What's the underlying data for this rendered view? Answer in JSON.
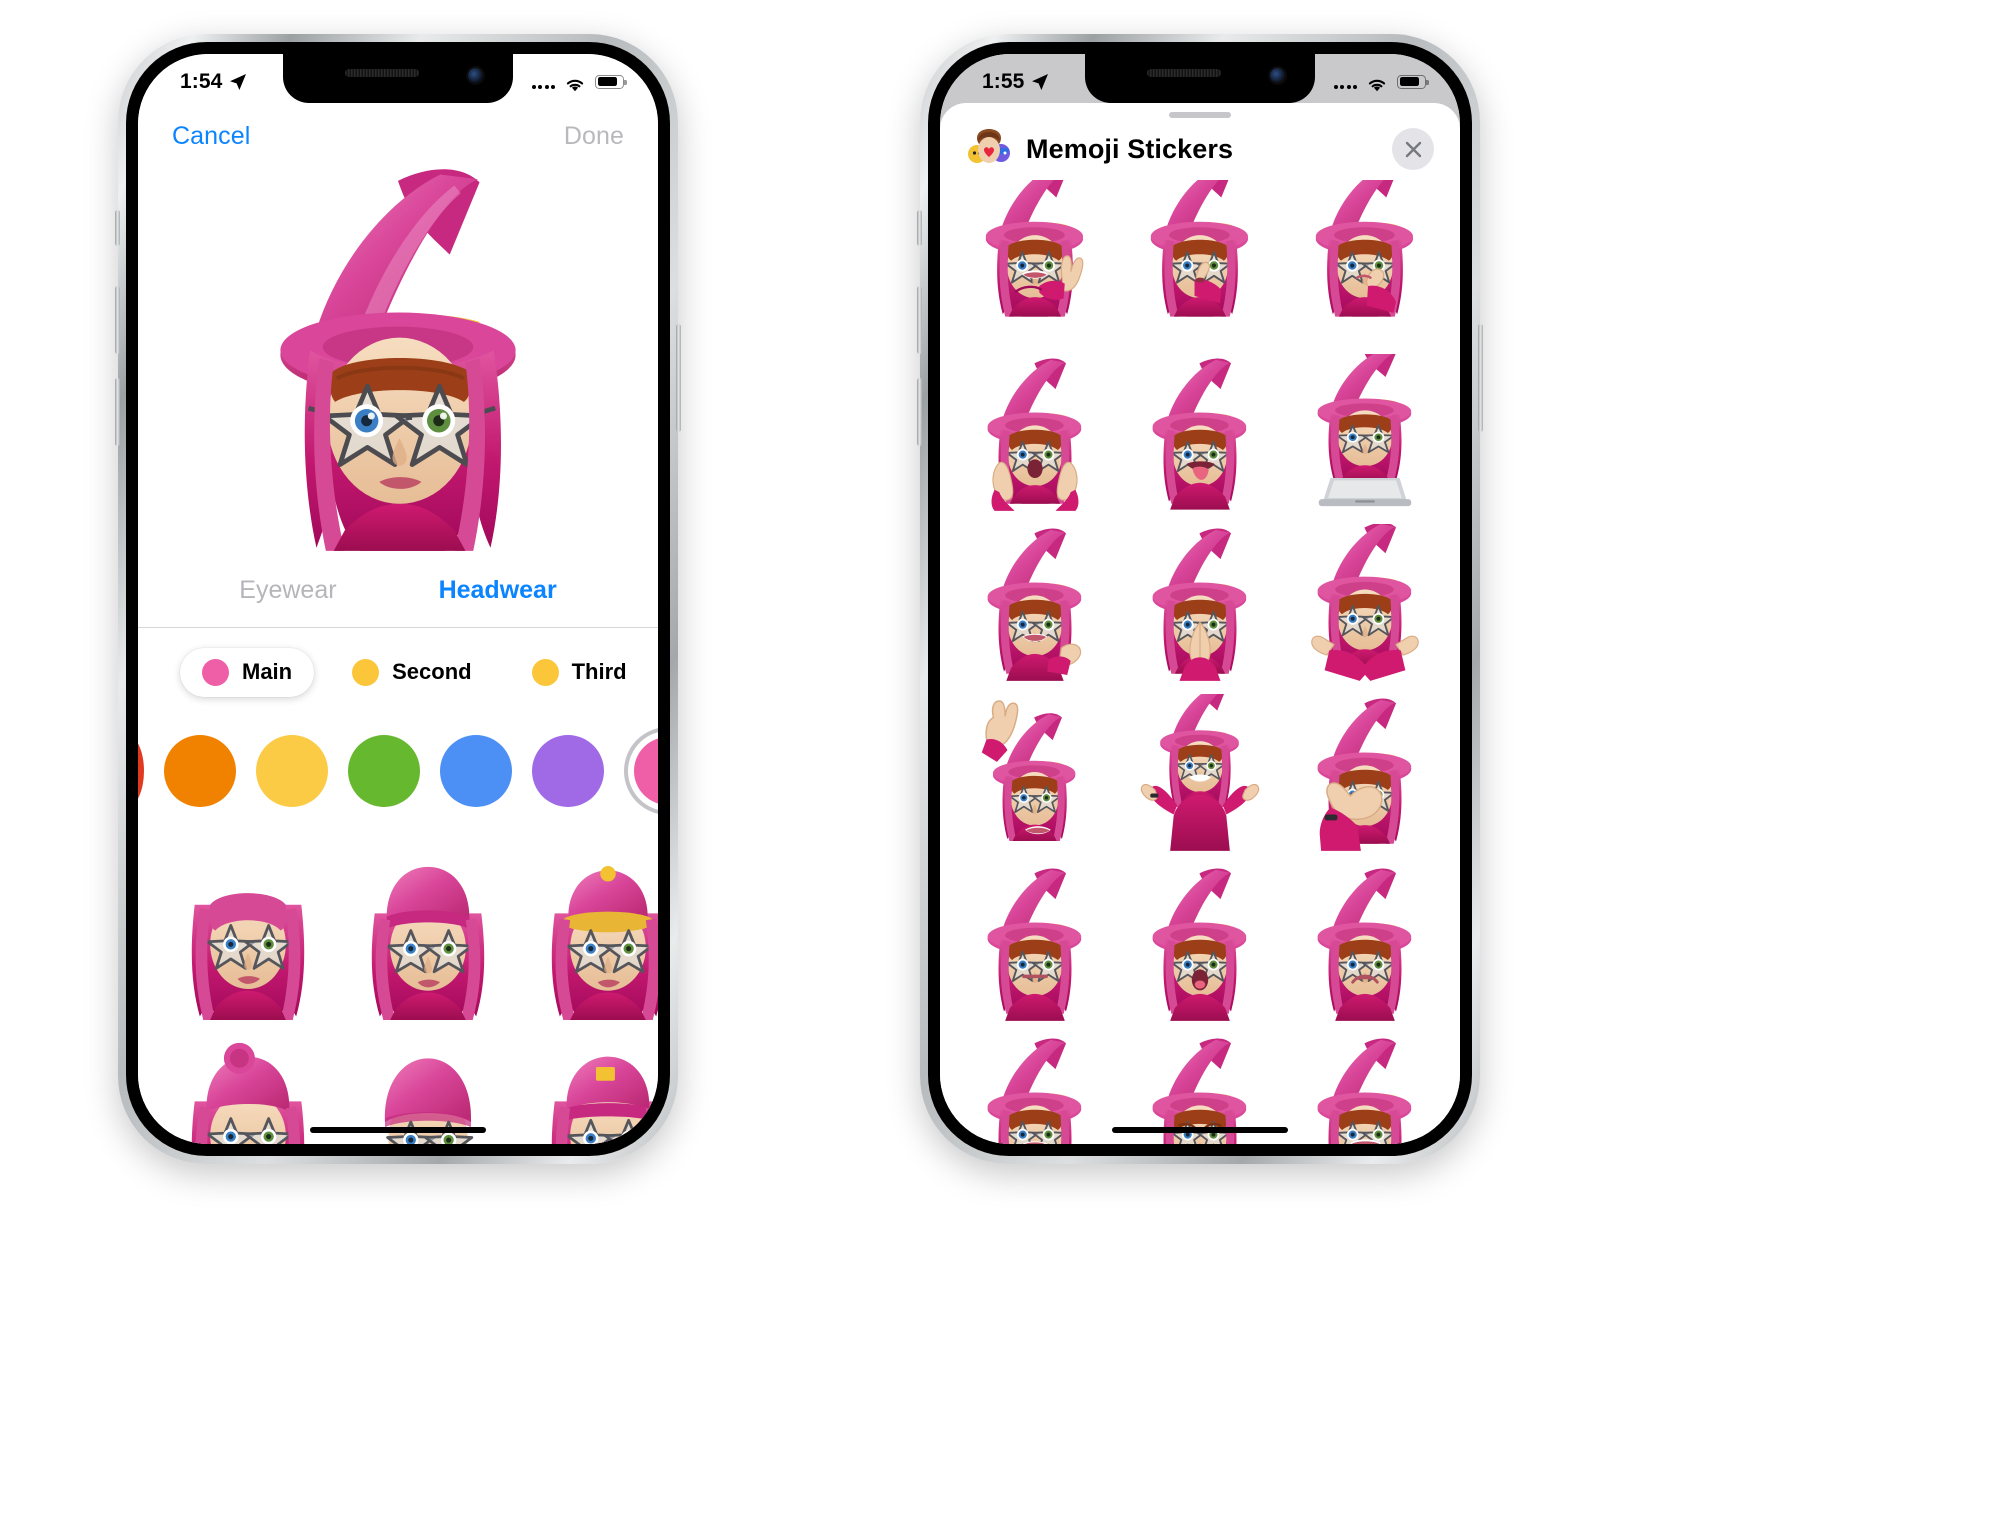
{
  "phones": [
    {
      "id": "memoji-editor",
      "status_bar": {
        "time": "1:54",
        "location_icon": "location-arrow-icon",
        "cellular_icon": "cellular-dots-icon",
        "wifi_icon": "wifi-icon",
        "battery_icon": "battery-icon",
        "battery_level_pct": 82,
        "recording_dot": true,
        "style": "light"
      },
      "nav": {
        "cancel_label": "Cancel",
        "done_label": "Done",
        "done_enabled": false
      },
      "tabs": [
        {
          "label": "Eyewear",
          "active": false
        },
        {
          "label": "Headwear",
          "active": true
        }
      ],
      "color_slots": [
        {
          "label": "Main",
          "color": "#ee5fa7",
          "selected": true
        },
        {
          "label": "Second",
          "color": "#fcc63b",
          "selected": false
        },
        {
          "label": "Third",
          "color": "#fcc63b",
          "selected": false
        }
      ],
      "swatches": [
        {
          "name": "red",
          "color": "#e03a21",
          "selected": false,
          "clipped": true
        },
        {
          "name": "orange",
          "color": "#f08200",
          "selected": false
        },
        {
          "name": "yellow",
          "color": "#fbcb45",
          "selected": false
        },
        {
          "name": "green",
          "color": "#66b92e",
          "selected": false
        },
        {
          "name": "blue",
          "color": "#4d90f5",
          "selected": false
        },
        {
          "name": "purple",
          "color": "#a06ae6",
          "selected": false
        },
        {
          "name": "pink",
          "color": "#ee5fa7",
          "selected": true
        }
      ],
      "headwear_options": [
        {
          "name": "no-hat-bangs",
          "hat": "none",
          "hat_color": "#d63d8b"
        },
        {
          "name": "beanie",
          "hat": "beanie",
          "hat_color": "#e05ba3"
        },
        {
          "name": "cap-with-button",
          "hat": "cap",
          "hat_color": "#e05ba3"
        },
        {
          "name": "bun-headband",
          "hat": "bun",
          "hat_color": "#d63d8b"
        },
        {
          "name": "swim-cap",
          "hat": "swimcap",
          "hat_color": "#e05ba3"
        },
        {
          "name": "baseball-cap",
          "hat": "baseball",
          "hat_color": "#e05ba3"
        }
      ],
      "accent_color": "#0a84ff",
      "tab_inactive_color": "#b5b5ba"
    },
    {
      "id": "memoji-stickers",
      "status_bar": {
        "time": "1:55",
        "location_icon": "location-arrow-icon",
        "cellular_icon": "cellular-dots-icon",
        "wifi_icon": "wifi-icon",
        "battery_icon": "battery-icon",
        "battery_level_pct": 82,
        "recording_dot": true,
        "style": "gray"
      },
      "sheet": {
        "app_icon": "memoji-stickers-app-icon",
        "title": "Memoji Stickers",
        "close_icon": "close-icon",
        "grabber": true
      },
      "stickers": [
        {
          "name": "sticker-peace-sign",
          "pose": "peace",
          "clipped": true
        },
        {
          "name": "sticker-shush",
          "pose": "shush",
          "clipped": true
        },
        {
          "name": "sticker-thinking",
          "pose": "thinking",
          "clipped": true
        },
        {
          "name": "sticker-shocked-hands",
          "pose": "shocked"
        },
        {
          "name": "sticker-tongue-out",
          "pose": "tongue"
        },
        {
          "name": "sticker-laptop",
          "pose": "laptop"
        },
        {
          "name": "sticker-wave-hand",
          "pose": "wave-small"
        },
        {
          "name": "sticker-praying",
          "pose": "pray"
        },
        {
          "name": "sticker-arms-crossed-x",
          "pose": "arms-x"
        },
        {
          "name": "sticker-raised-hand",
          "pose": "raised-hand"
        },
        {
          "name": "sticker-shrug",
          "pose": "shrug"
        },
        {
          "name": "sticker-facepalm",
          "pose": "facepalm"
        },
        {
          "name": "sticker-neutral",
          "pose": "neutral"
        },
        {
          "name": "sticker-surprised",
          "pose": "surprised"
        },
        {
          "name": "sticker-sad",
          "pose": "sad"
        },
        {
          "name": "sticker-happy",
          "pose": "happy"
        },
        {
          "name": "sticker-frown",
          "pose": "frown"
        },
        {
          "name": "sticker-smile-wide",
          "pose": "smile-wide"
        }
      ]
    }
  ],
  "palette": {
    "hat_pink": "#e05ba3",
    "hat_pink_dark": "#c6297f",
    "hair_magenta": "#c2186f",
    "hair_magenta_light": "#e0559f",
    "skin": "#f0cfae",
    "hat_band": "#f2c233",
    "shirt": "#bf1463",
    "accent_blue": "#0a84ff"
  }
}
